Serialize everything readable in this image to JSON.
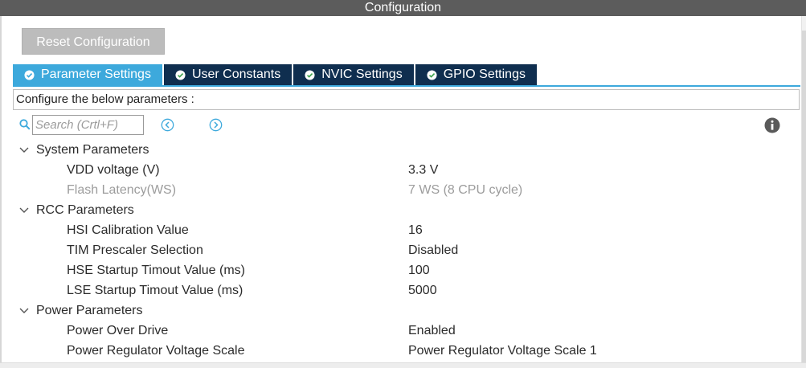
{
  "window": {
    "title": "Configuration"
  },
  "toolbar": {
    "reset_label": "Reset Configuration"
  },
  "tabs": [
    {
      "label": "Parameter Settings",
      "active": true
    },
    {
      "label": "User Constants",
      "active": false
    },
    {
      "label": "NVIC Settings",
      "active": false
    },
    {
      "label": "GPIO Settings",
      "active": false
    }
  ],
  "description": "Configure the below parameters :",
  "search": {
    "placeholder": "Search (Crtl+F)"
  },
  "groups": [
    {
      "label": "System Parameters",
      "params": [
        {
          "name": "VDD voltage (V)",
          "value": "3.3 V",
          "disabled": false
        },
        {
          "name": "Flash Latency(WS)",
          "value": "7 WS (8 CPU cycle)",
          "disabled": true
        }
      ]
    },
    {
      "label": "RCC Parameters",
      "params": [
        {
          "name": "HSI Calibration Value",
          "value": "16",
          "disabled": false
        },
        {
          "name": "TIM Prescaler Selection",
          "value": "Disabled",
          "disabled": false
        },
        {
          "name": "HSE Startup Timout Value (ms)",
          "value": "100",
          "disabled": false
        },
        {
          "name": "LSE Startup Timout Value (ms)",
          "value": "5000",
          "disabled": false
        }
      ]
    },
    {
      "label": "Power Parameters",
      "params": [
        {
          "name": "Power Over Drive",
          "value": "Enabled",
          "disabled": false
        },
        {
          "name": "Power Regulator Voltage Scale",
          "value": "Power Regulator Voltage Scale 1",
          "disabled": false
        }
      ]
    }
  ],
  "colors": {
    "titlebar": "#5c5c5c",
    "tab_active": "#3da9dc",
    "tab_inactive": "#0f2e4f",
    "reset_button": "#bcbcbc",
    "disabled_text": "#9c9c9c",
    "accent_icon": "#3da9dc"
  },
  "icons": {
    "tab_check": "check-circle-icon",
    "search": "search-icon",
    "prev": "previous-match-icon",
    "next": "next-match-icon",
    "info": "info-icon",
    "expand": "chevron-down-icon"
  }
}
